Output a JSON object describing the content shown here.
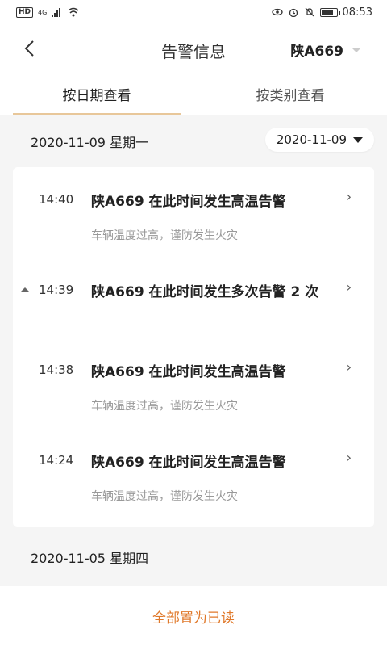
{
  "status_bar": {
    "left_badge": "HD",
    "signal_text": "4G",
    "time": "08:53",
    "battery_level": 0.75
  },
  "header": {
    "back_icon": "chevron-left-icon",
    "title": "告警信息",
    "vehicle_selector": "陕A669"
  },
  "tabs": [
    {
      "label": "按日期查看",
      "active": true
    },
    {
      "label": "按类别查看",
      "active": false
    }
  ],
  "date_picker": {
    "value": "2020-11-09"
  },
  "groups": [
    {
      "date_label": "2020-11-09 星期一",
      "items": [
        {
          "time": "14:40",
          "title": "陕A669 在此时间发生高温告警",
          "subtitle": "车辆温度过高，谨防发生火灾",
          "expanded": false
        },
        {
          "time": "14:39",
          "title": "陕A669 在此时间发生多次告警 2 次",
          "subtitle": "",
          "expanded": true
        },
        {
          "time": "14:38",
          "title": "陕A669 在此时间发生高温告警",
          "subtitle": "车辆温度过高，谨防发生火灾",
          "expanded": false
        },
        {
          "time": "14:24",
          "title": "陕A669 在此时间发生高温告警",
          "subtitle": "车辆温度过高，谨防发生火灾",
          "expanded": false
        }
      ]
    },
    {
      "date_label": "2020-11-05 星期四",
      "items": []
    }
  ],
  "bottom": {
    "mark_all_read": "全部置为已读"
  },
  "colors": {
    "accent": "#e0792b",
    "tab_indicator": "#e8c79a",
    "background": "#f5f5f5"
  }
}
